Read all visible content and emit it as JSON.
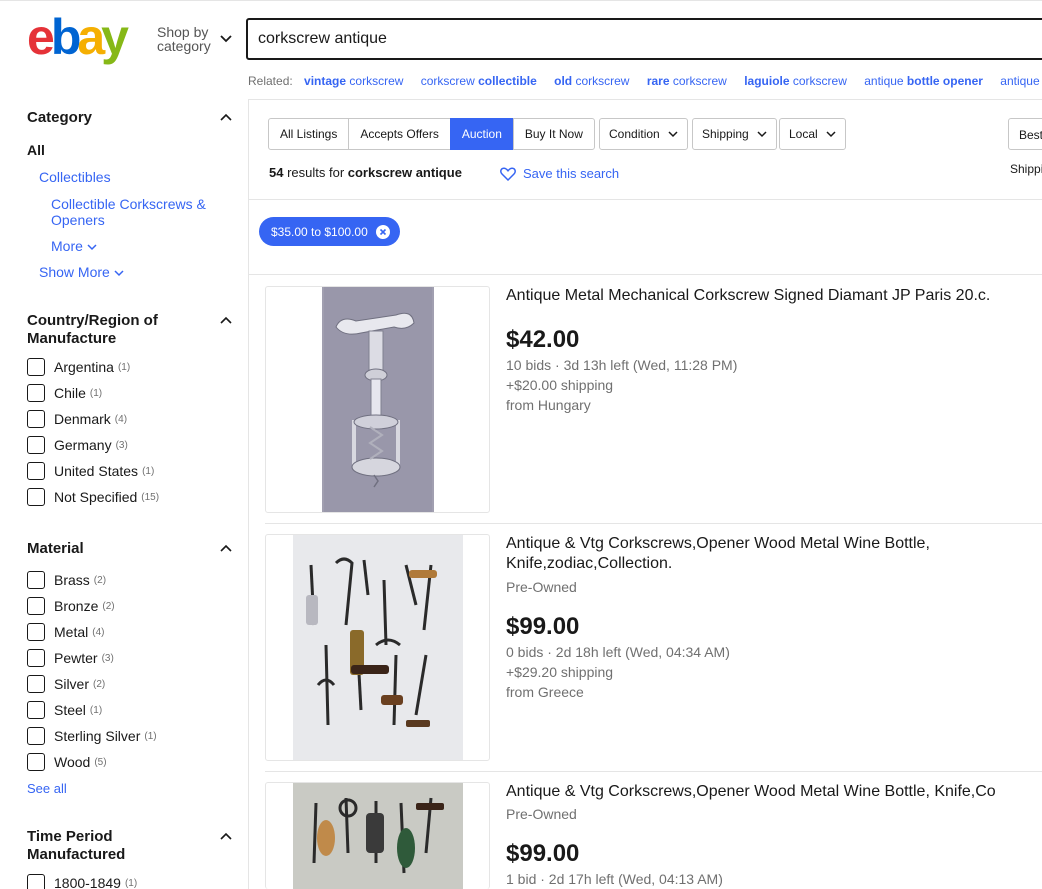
{
  "brand": {
    "logo_letters": [
      "e",
      "b",
      "a",
      "y"
    ],
    "colors": {
      "e": "#e53238",
      "b": "#0064d2",
      "a": "#f5af02",
      "y": "#86b817"
    }
  },
  "header": {
    "shop_by_line1": "Shop by",
    "shop_by_line2": "category",
    "search_value": "corkscrew antique"
  },
  "related": {
    "label": "Related:",
    "links": [
      {
        "bold": "vintage",
        "rest": " corkscrew",
        "bold_first": true
      },
      {
        "bold": "collectible",
        "rest": "corkscrew ",
        "bold_first": false
      },
      {
        "bold": "old",
        "rest": " corkscrew",
        "bold_first": true
      },
      {
        "bold": "rare",
        "rest": " corkscrew",
        "bold_first": true
      },
      {
        "bold": "laguiole",
        "rest": " corkscrew",
        "bold_first": true
      },
      {
        "bold": "bottle opener",
        "rest": "antique ",
        "bold_first": false
      },
      {
        "bold": "",
        "rest": "antique cor",
        "bold_first": false
      }
    ]
  },
  "sidebar": {
    "category": {
      "title": "Category",
      "all": "All",
      "collectibles": "Collectibles",
      "sub_line1": "Collectible Corkscrews &",
      "sub_line2": "Openers",
      "more": "More",
      "show_more": "Show More"
    },
    "country": {
      "title_line1": "Country/Region of",
      "title_line2": "Manufacture",
      "items": [
        {
          "label": "Argentina",
          "count": "(1)"
        },
        {
          "label": "Chile",
          "count": "(1)"
        },
        {
          "label": "Denmark",
          "count": "(4)"
        },
        {
          "label": "Germany",
          "count": "(3)"
        },
        {
          "label": "United States",
          "count": "(1)"
        },
        {
          "label": "Not Specified",
          "count": "(15)"
        }
      ]
    },
    "material": {
      "title": "Material",
      "items": [
        {
          "label": "Brass",
          "count": "(2)"
        },
        {
          "label": "Bronze",
          "count": "(2)"
        },
        {
          "label": "Metal",
          "count": "(4)"
        },
        {
          "label": "Pewter",
          "count": "(3)"
        },
        {
          "label": "Silver",
          "count": "(2)"
        },
        {
          "label": "Steel",
          "count": "(1)"
        },
        {
          "label": "Sterling Silver",
          "count": "(1)"
        },
        {
          "label": "Wood",
          "count": "(5)"
        }
      ],
      "see_all": "See all"
    },
    "time_period": {
      "title_line1": "Time Period",
      "title_line2": "Manufactured",
      "items": [
        {
          "label": "1800-1849",
          "count": "(1)"
        }
      ]
    }
  },
  "toolbar": {
    "tabs": [
      "All Listings",
      "Accepts Offers",
      "Auction",
      "Buy It Now"
    ],
    "active_tab": "Auction",
    "dropdowns": [
      "Condition",
      "Shipping",
      "Local"
    ],
    "sort_label": "Best",
    "ship_to": "Shippi"
  },
  "results": {
    "count": "54",
    "text": " results for ",
    "query": "corkscrew antique",
    "save_search": "Save this search"
  },
  "filter_chip": {
    "label": "$35.00 to $100.00"
  },
  "listings": [
    {
      "title": "Antique Metal Mechanical Corkscrew Signed Diamant JP Paris 20.c.",
      "subtitle": "",
      "price": "$42.00",
      "bids": "10 bids · 3d 13h left (Wed, 11:28 PM)",
      "shipping": "+$20.00 shipping",
      "location": "from Hungary"
    },
    {
      "title_line1": "Antique & Vtg Corkscrews,Opener Wood Metal Wine Bottle,",
      "title_line2": "Knife,zodiac,Collection.",
      "subtitle": "Pre-Owned",
      "price": "$99.00",
      "bids": "0 bids · 2d 18h left (Wed, 04:34 AM)",
      "shipping": "+$29.20 shipping",
      "location": "from Greece"
    },
    {
      "title": "Antique & Vtg Corkscrews,Opener Wood Metal Wine Bottle, Knife,Co",
      "subtitle": "Pre-Owned",
      "price": "$99.00",
      "bids": "1 bid · 2d 17h left (Wed, 04:13 AM)"
    }
  ],
  "icons": {
    "shop_by_chevron": "chevron-down-icon",
    "section_collapse": "chevron-up-icon",
    "save_heart": "heart-icon",
    "chip_remove": "close-circle-icon",
    "dropdown": "chevron-down-icon"
  }
}
